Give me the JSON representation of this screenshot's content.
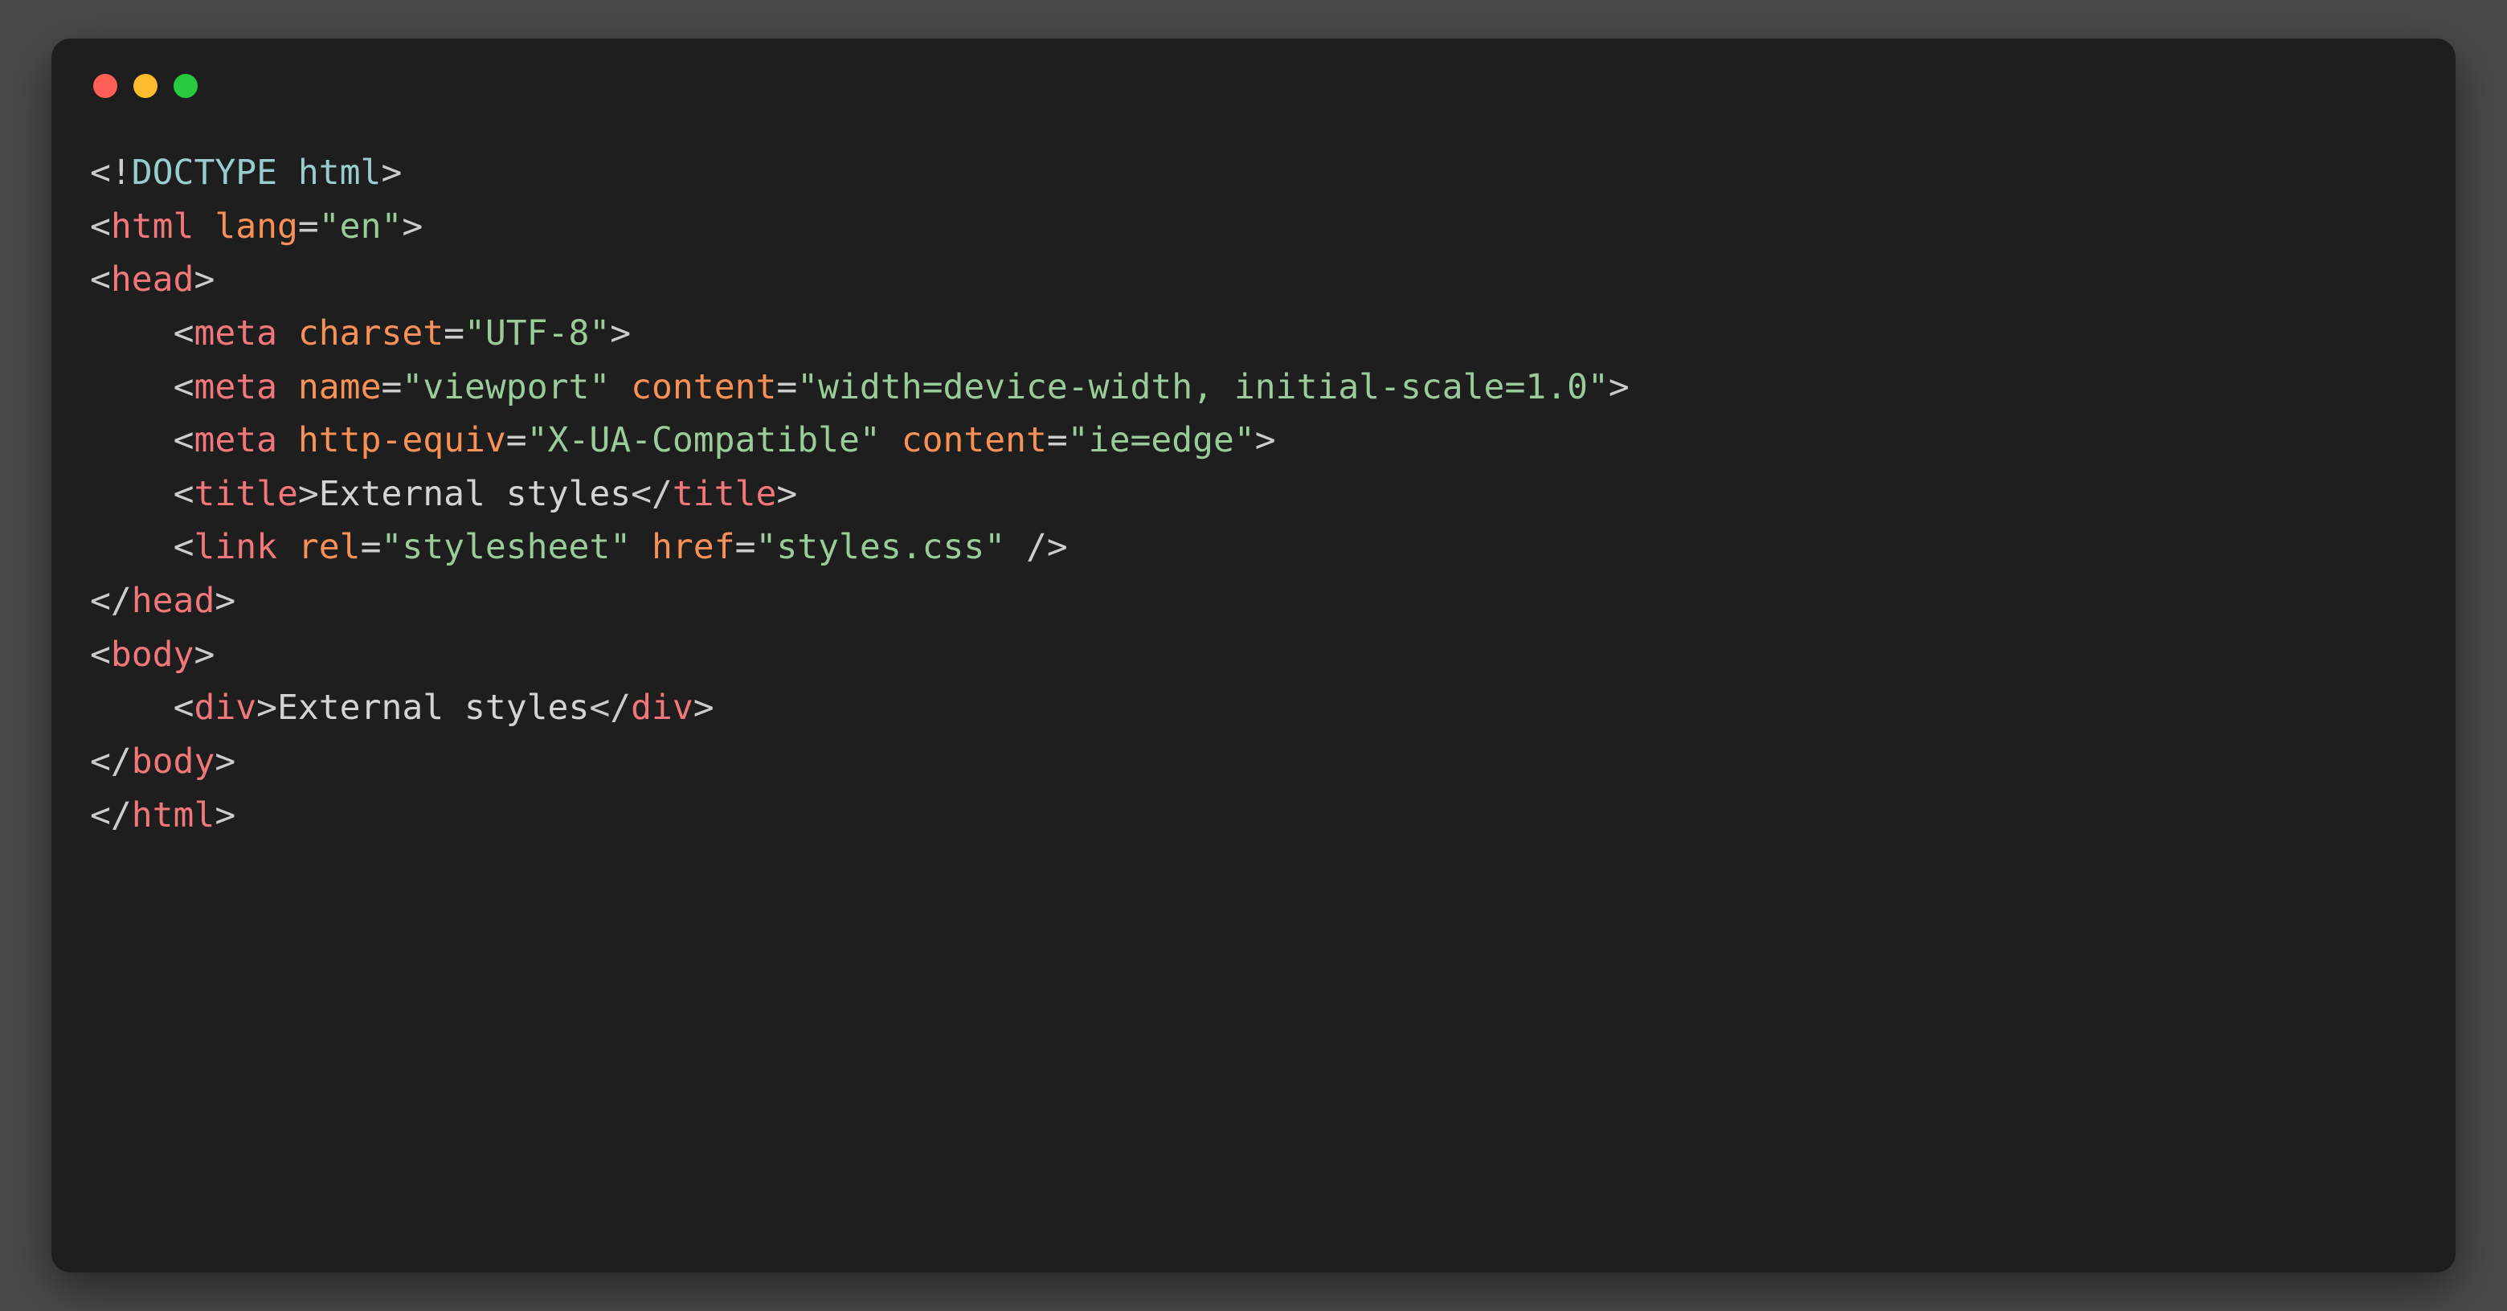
{
  "window": {
    "traffic_lights": {
      "red": "#ff5f56",
      "yellow": "#ffbd2e",
      "green": "#27c93f"
    }
  },
  "code": {
    "lines": [
      {
        "indent": "",
        "tokens": [
          {
            "t": "<!",
            "c": "punct"
          },
          {
            "t": "DOCTYPE html",
            "c": "doctype-word"
          },
          {
            "t": ">",
            "c": "punct"
          }
        ]
      },
      {
        "indent": "",
        "tokens": [
          {
            "t": "<",
            "c": "punct"
          },
          {
            "t": "html",
            "c": "tag"
          },
          {
            "t": " ",
            "c": "punct"
          },
          {
            "t": "lang",
            "c": "attr"
          },
          {
            "t": "=",
            "c": "punct"
          },
          {
            "t": "\"en\"",
            "c": "string"
          },
          {
            "t": ">",
            "c": "punct"
          }
        ]
      },
      {
        "indent": "",
        "tokens": [
          {
            "t": "<",
            "c": "punct"
          },
          {
            "t": "head",
            "c": "tag"
          },
          {
            "t": ">",
            "c": "punct"
          }
        ]
      },
      {
        "indent": "    ",
        "tokens": [
          {
            "t": "<",
            "c": "punct"
          },
          {
            "t": "meta",
            "c": "tag"
          },
          {
            "t": " ",
            "c": "punct"
          },
          {
            "t": "charset",
            "c": "attr"
          },
          {
            "t": "=",
            "c": "punct"
          },
          {
            "t": "\"UTF-8\"",
            "c": "string"
          },
          {
            "t": ">",
            "c": "punct"
          }
        ]
      },
      {
        "indent": "    ",
        "tokens": [
          {
            "t": "<",
            "c": "punct"
          },
          {
            "t": "meta",
            "c": "tag"
          },
          {
            "t": " ",
            "c": "punct"
          },
          {
            "t": "name",
            "c": "attr"
          },
          {
            "t": "=",
            "c": "punct"
          },
          {
            "t": "\"viewport\"",
            "c": "string"
          },
          {
            "t": " ",
            "c": "punct"
          },
          {
            "t": "content",
            "c": "attr"
          },
          {
            "t": "=",
            "c": "punct"
          },
          {
            "t": "\"width=device-width, initial-scale=1.0\"",
            "c": "string"
          },
          {
            "t": ">",
            "c": "punct"
          }
        ]
      },
      {
        "indent": "    ",
        "tokens": [
          {
            "t": "<",
            "c": "punct"
          },
          {
            "t": "meta",
            "c": "tag"
          },
          {
            "t": " ",
            "c": "punct"
          },
          {
            "t": "http-equiv",
            "c": "attr"
          },
          {
            "t": "=",
            "c": "punct"
          },
          {
            "t": "\"X-UA-Compatible\"",
            "c": "string"
          },
          {
            "t": " ",
            "c": "punct"
          },
          {
            "t": "content",
            "c": "attr"
          },
          {
            "t": "=",
            "c": "punct"
          },
          {
            "t": "\"ie=edge\"",
            "c": "string"
          },
          {
            "t": ">",
            "c": "punct"
          }
        ]
      },
      {
        "indent": "    ",
        "tokens": [
          {
            "t": "<",
            "c": "punct"
          },
          {
            "t": "title",
            "c": "tag"
          },
          {
            "t": ">",
            "c": "punct"
          },
          {
            "t": "External styles",
            "c": "text"
          },
          {
            "t": "</",
            "c": "punct"
          },
          {
            "t": "title",
            "c": "tag"
          },
          {
            "t": ">",
            "c": "punct"
          }
        ]
      },
      {
        "indent": "    ",
        "tokens": [
          {
            "t": "<",
            "c": "punct"
          },
          {
            "t": "link",
            "c": "tag"
          },
          {
            "t": " ",
            "c": "punct"
          },
          {
            "t": "rel",
            "c": "attr"
          },
          {
            "t": "=",
            "c": "punct"
          },
          {
            "t": "\"stylesheet\"",
            "c": "string"
          },
          {
            "t": " ",
            "c": "punct"
          },
          {
            "t": "href",
            "c": "attr"
          },
          {
            "t": "=",
            "c": "punct"
          },
          {
            "t": "\"styles.css\"",
            "c": "string"
          },
          {
            "t": " />",
            "c": "punct"
          }
        ]
      },
      {
        "indent": "",
        "tokens": [
          {
            "t": "</",
            "c": "punct"
          },
          {
            "t": "head",
            "c": "tag"
          },
          {
            "t": ">",
            "c": "punct"
          }
        ]
      },
      {
        "indent": "",
        "tokens": [
          {
            "t": "<",
            "c": "punct"
          },
          {
            "t": "body",
            "c": "tag"
          },
          {
            "t": ">",
            "c": "punct"
          }
        ]
      },
      {
        "indent": "    ",
        "tokens": [
          {
            "t": "<",
            "c": "punct"
          },
          {
            "t": "div",
            "c": "tag"
          },
          {
            "t": ">",
            "c": "punct"
          },
          {
            "t": "External styles",
            "c": "text"
          },
          {
            "t": "</",
            "c": "punct"
          },
          {
            "t": "div",
            "c": "tag"
          },
          {
            "t": ">",
            "c": "punct"
          }
        ]
      },
      {
        "indent": "",
        "tokens": [
          {
            "t": "</",
            "c": "punct"
          },
          {
            "t": "body",
            "c": "tag"
          },
          {
            "t": ">",
            "c": "punct"
          }
        ]
      },
      {
        "indent": "",
        "tokens": [
          {
            "t": "</",
            "c": "punct"
          },
          {
            "t": "html",
            "c": "tag"
          },
          {
            "t": ">",
            "c": "punct"
          }
        ]
      }
    ]
  }
}
